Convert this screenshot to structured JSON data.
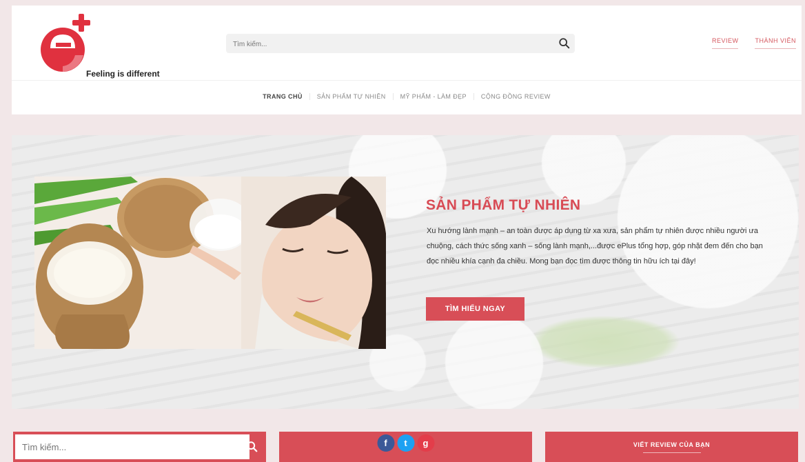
{
  "brand": {
    "tagline": "Feeling is different"
  },
  "header": {
    "search_placeholder": "Tìm kiếm...",
    "links": [
      "REVIEW",
      "THÀNH VIÊN"
    ]
  },
  "nav": {
    "items": [
      "TRANG CHỦ",
      "SẢN PHẨM TỰ NHIÊN",
      "MỸ PHẨM - LÀM ĐẸP",
      "CỘNG ĐỒNG REVIEW"
    ]
  },
  "hero": {
    "title": "SẢN PHẨM TỰ NHIÊN",
    "description": "Xu hướng lành mạnh – an toàn được áp dụng từ xa xưa, sản phẩm tự nhiên được nhiều người ưa chuộng, cách thức sống xanh – sống lành mạnh,...được ePlus tổng hợp, góp nhặt đem đến cho bạn đọc nhiều khía cạnh đa chiều. Mong bạn đọc tìm được thông tin hữu ích tại đây!",
    "button": "TÌM HIỂU NGAY"
  },
  "bottom": {
    "search_placeholder": "Tìm kiếm...",
    "social": [
      "f",
      "t",
      "g"
    ],
    "write_review": "VIẾT REVIEW CỦA BẠN"
  },
  "colors": {
    "accent": "#d84e57",
    "page_bg": "#f2e7e8"
  }
}
